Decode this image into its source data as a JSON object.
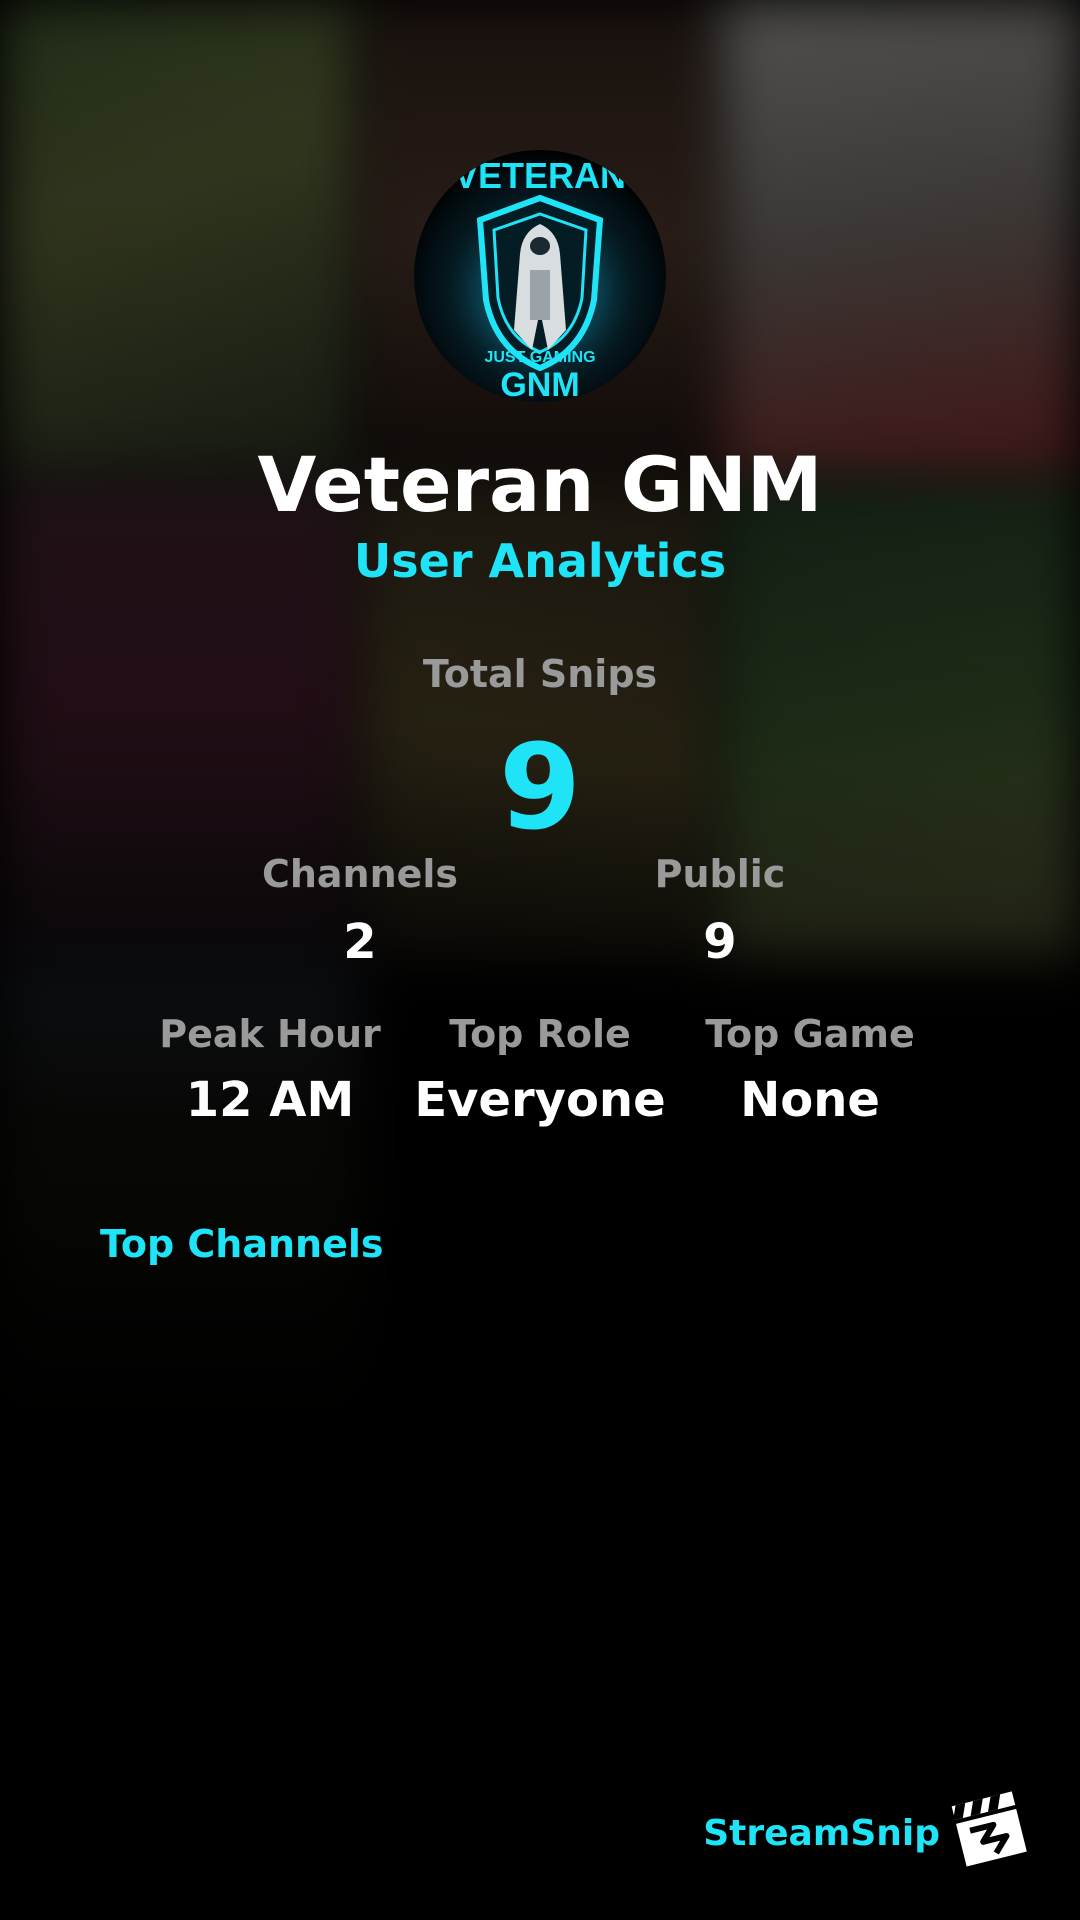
{
  "profile": {
    "name": "Veteran GNM",
    "subtitle": "User Analytics",
    "avatar_text_top": "VETERAN",
    "avatar_text_mid": "JUST GAMING",
    "avatar_text_bottom": "GNM"
  },
  "stats": {
    "total_snips_label": "Total Snips",
    "total_snips_value": "9",
    "channels_label": "Channels",
    "channels_value": "2",
    "public_label": "Public",
    "public_value": "9",
    "peak_hour_label": "Peak Hour",
    "peak_hour_value": "12 AM",
    "top_role_label": "Top Role",
    "top_role_value": "Everyone",
    "top_game_label": "Top Game",
    "top_game_value": "None"
  },
  "sections": {
    "top_channels_title": "Top Channels"
  },
  "brand": {
    "name": "StreamSnip",
    "logo_icon": "clapperboard-icon"
  },
  "colors": {
    "accent": "#1fe3f7",
    "label": "#9a9a9a",
    "value": "#ffffff",
    "background": "#000000"
  }
}
